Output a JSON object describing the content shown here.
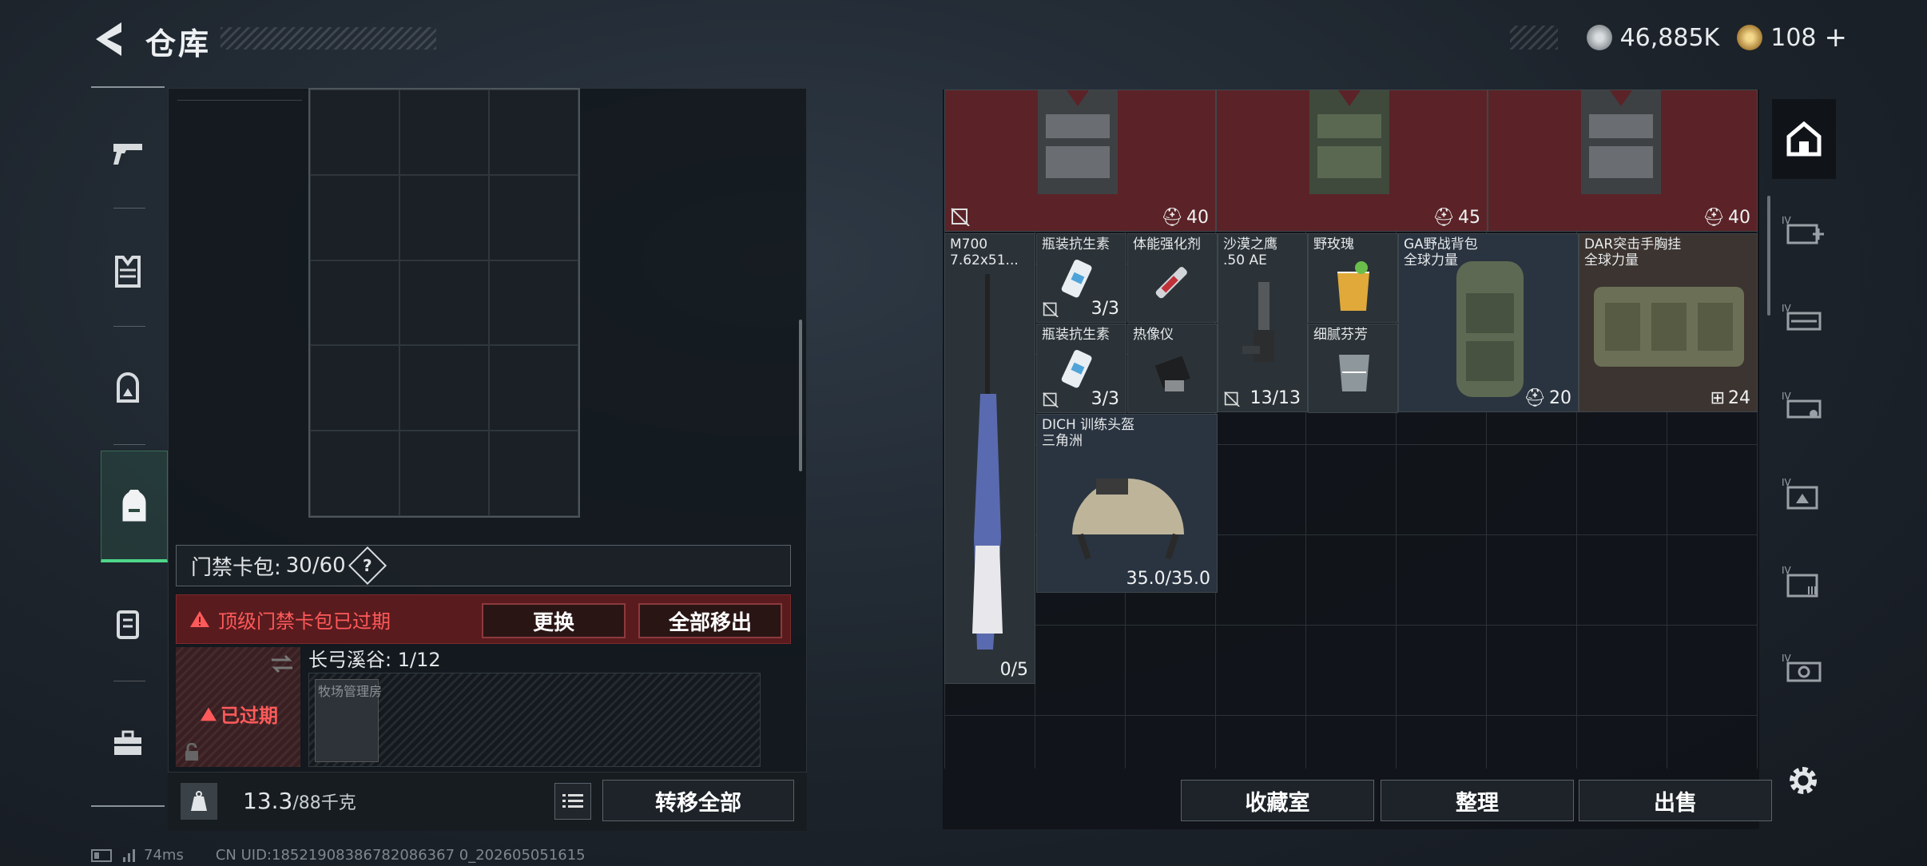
{
  "header": {
    "title": "仓库",
    "back_icon": "back-arrow-icon"
  },
  "currency": {
    "silver": "46,885K",
    "gold": "108",
    "plus": "+"
  },
  "left_tabs": [
    {
      "icon": "pistol-icon"
    },
    {
      "icon": "armor-vest-icon"
    },
    {
      "icon": "helmet-icon"
    },
    {
      "icon": "backpack-icon",
      "selected": true
    },
    {
      "icon": "chest-rig-icon"
    },
    {
      "icon": "toolbox-icon"
    }
  ],
  "keycard": {
    "label": "门禁卡包:",
    "value": "30/60",
    "help": "?",
    "warning": "顶级门禁卡包已过期",
    "replace_btn": "更换",
    "remove_all_btn": "全部移出",
    "expired_badge": "已过期",
    "map_label": "长弓溪谷: 1/12",
    "slot_label": "牧场管理房"
  },
  "footer_left": {
    "weight": "13.3",
    "weight_max": "/88千克",
    "transfer_all": "转移全部"
  },
  "items": [
    {
      "id": "vest1",
      "count": "40"
    },
    {
      "id": "vest2",
      "count": "45"
    },
    {
      "id": "vest3",
      "count": "40"
    },
    {
      "id": "m700",
      "name": "M700\n7.62x51...",
      "count": "0/5"
    },
    {
      "id": "anti1",
      "name": "瓶装抗生素",
      "count": "3/3"
    },
    {
      "id": "stim",
      "name": "体能强化剂"
    },
    {
      "id": "deagle",
      "name": "沙漠之鹰\n.50 AE",
      "count": "13/13"
    },
    {
      "id": "rose",
      "name": "野玫瑰"
    },
    {
      "id": "ga_bag",
      "name": "GA野战背包\n全球力量",
      "count": "20"
    },
    {
      "id": "dar_rig",
      "name": "DAR突击手胸挂\n全球力量",
      "count": "24"
    },
    {
      "id": "anti2",
      "name": "瓶装抗生素",
      "count": "3/3"
    },
    {
      "id": "thermal",
      "name": "热像仪"
    },
    {
      "id": "fentanyl",
      "name": "细腻芬芳"
    },
    {
      "id": "helmet",
      "name": "DICH 训练头盔\n三角洲",
      "count": "35.0/35.0"
    }
  ],
  "footer_right": {
    "collection": "收藏室",
    "sort": "整理",
    "sell": "出售"
  },
  "right_tabs": [
    "safehouse-icon",
    "stash-1-icon",
    "stash-2-icon",
    "stash-3-icon",
    "stash-4-icon",
    "stash-5-icon",
    "stash-6-icon"
  ],
  "status": {
    "ping": "74ms",
    "uid": "CN UID:18521908386782086367 0_202605051615"
  }
}
